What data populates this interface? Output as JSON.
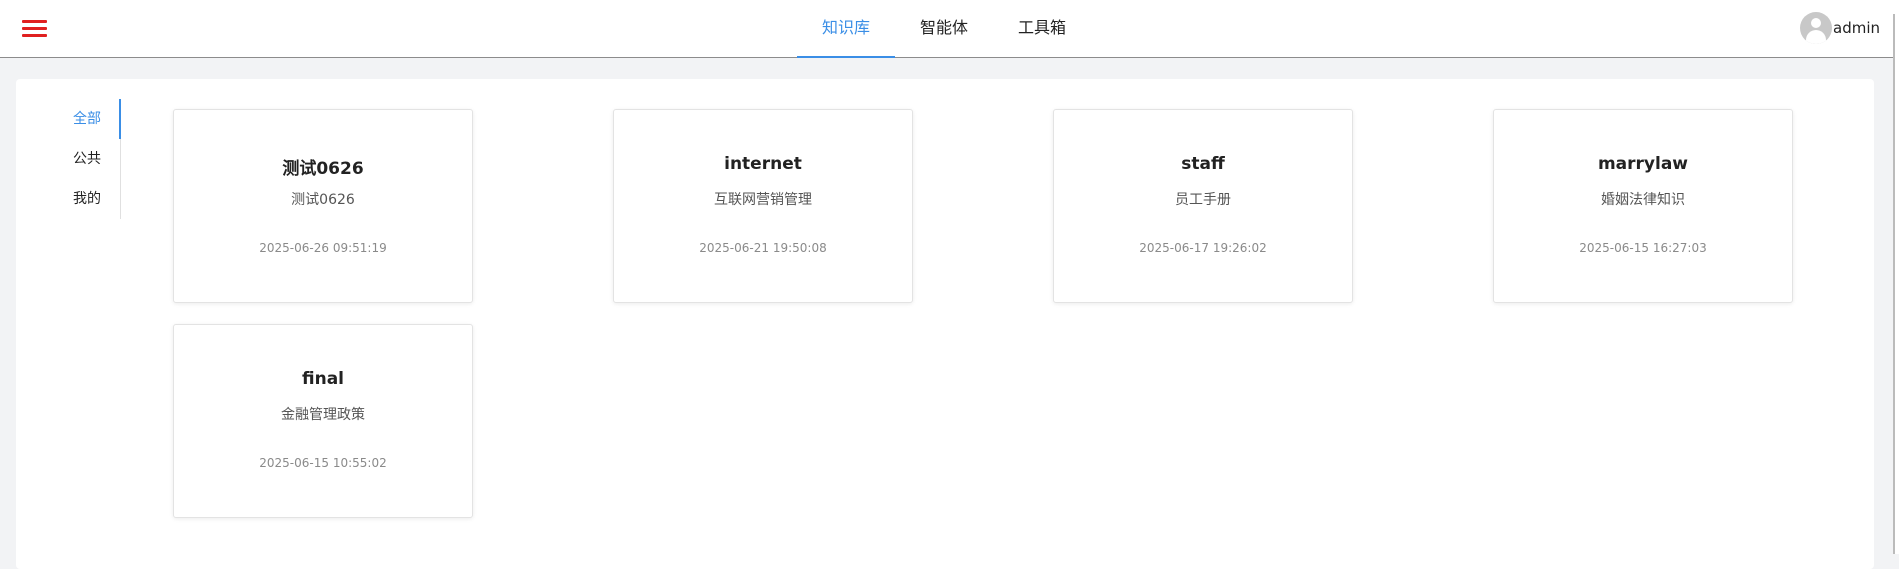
{
  "header": {
    "menu_icon": "hamburger-menu-icon",
    "menu_color": "#e02020",
    "tabs": [
      {
        "label": "知识库",
        "active": true
      },
      {
        "label": "智能体",
        "active": false
      },
      {
        "label": "工具箱",
        "active": false
      }
    ],
    "user": {
      "avatar_icon": "user-avatar-icon",
      "name": "admin"
    }
  },
  "sidebar": {
    "items": [
      {
        "label": "全部",
        "active": true
      },
      {
        "label": "公共",
        "active": false
      },
      {
        "label": "我的",
        "active": false
      }
    ]
  },
  "cards": [
    {
      "title": "测试0626",
      "desc": "测试0626",
      "date": "2025-06-26 09:51:19"
    },
    {
      "title": "internet",
      "desc": "互联网营销管理",
      "date": "2025-06-21 19:50:08"
    },
    {
      "title": "staff",
      "desc": "员工手册",
      "date": "2025-06-17 19:26:02"
    },
    {
      "title": "marrylaw",
      "desc": "婚姻法律知识",
      "date": "2025-06-15 16:27:03"
    },
    {
      "title": "final",
      "desc": "金融管理政策",
      "date": "2025-06-15 10:55:02"
    }
  ],
  "colors": {
    "accent": "#3a8ee6",
    "background": "#f2f3f5"
  }
}
